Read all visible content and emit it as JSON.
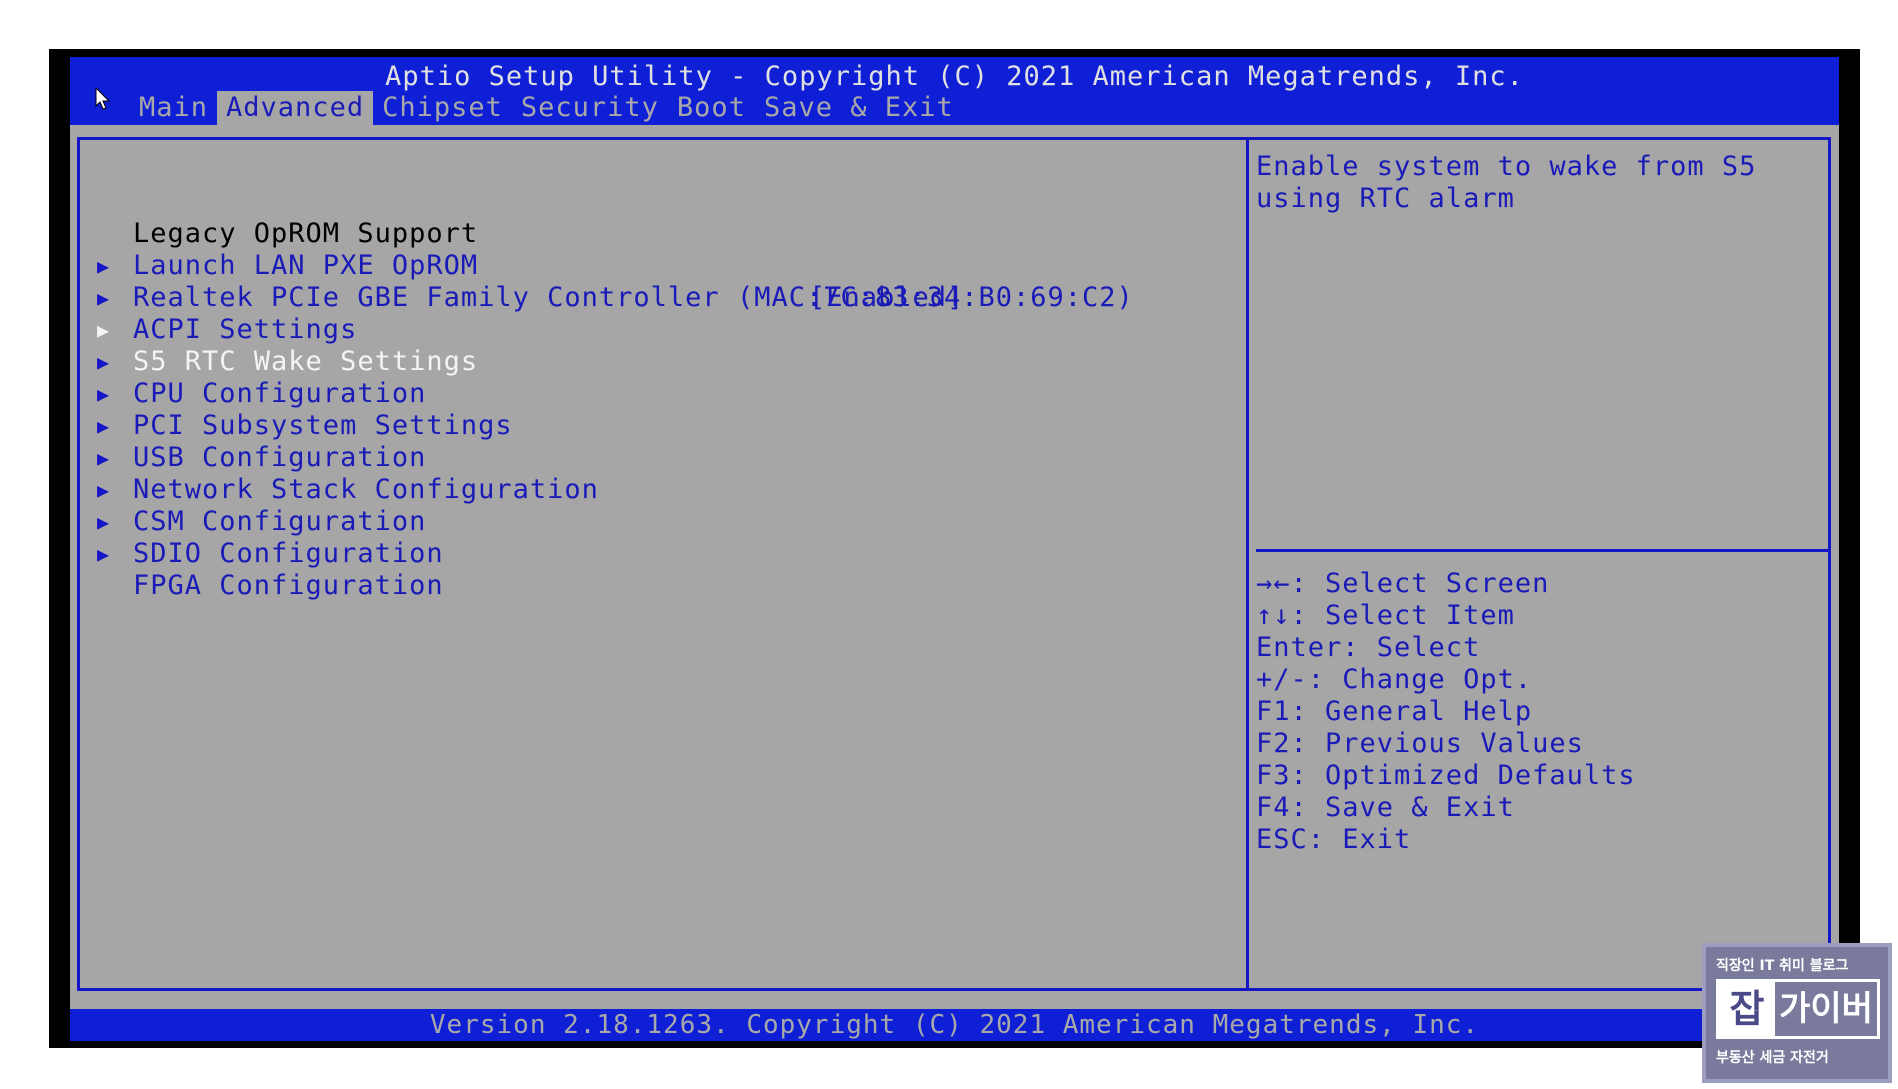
{
  "header": {
    "title": "Aptio Setup Utility - Copyright (C) 2021 American Megatrends, Inc.",
    "tabs": [
      {
        "label": "Main",
        "active": false
      },
      {
        "label": "Advanced",
        "active": true
      },
      {
        "label": "Chipset",
        "active": false
      },
      {
        "label": "Security",
        "active": false
      },
      {
        "label": "Boot",
        "active": false
      },
      {
        "label": "Save & Exit",
        "active": false
      }
    ]
  },
  "menu": {
    "items": [
      {
        "label": "Legacy OpROM Support",
        "type": "heading",
        "value": "",
        "arrow": ""
      },
      {
        "label": "Launch LAN PXE OpROM",
        "type": "option",
        "value": "[Enabled]",
        "arrow": ""
      },
      {
        "label": "Realtek PCIe GBE Family Controller (MAC:7C:83:34:B0:69:C2)",
        "type": "submenu",
        "value": "",
        "arrow": "▶"
      },
      {
        "label": "ACPI Settings",
        "type": "submenu",
        "value": "",
        "arrow": "▶"
      },
      {
        "label": "S5 RTC Wake Settings",
        "type": "submenu",
        "value": "",
        "arrow": "▶",
        "selected": true
      },
      {
        "label": "CPU Configuration",
        "type": "submenu",
        "value": "",
        "arrow": "▶"
      },
      {
        "label": "PCI Subsystem Settings",
        "type": "submenu",
        "value": "",
        "arrow": "▶"
      },
      {
        "label": "USB Configuration",
        "type": "submenu",
        "value": "",
        "arrow": "▶"
      },
      {
        "label": "Network Stack Configuration",
        "type": "submenu",
        "value": "",
        "arrow": "▶"
      },
      {
        "label": "CSM Configuration",
        "type": "submenu",
        "value": "",
        "arrow": "▶"
      },
      {
        "label": "SDIO Configuration",
        "type": "submenu",
        "value": "",
        "arrow": "▶"
      },
      {
        "label": "FPGA Configuration",
        "type": "submenu",
        "value": "",
        "arrow": "▶"
      }
    ]
  },
  "help": {
    "lines": [
      "Enable system to wake from S5",
      "using RTC alarm"
    ]
  },
  "keys": [
    "→←: Select Screen",
    "↑↓: Select Item",
    "Enter: Select",
    "+/-: Change Opt.",
    "F1: General Help",
    "F2: Previous Values",
    "F3: Optimized Defaults",
    "F4: Save & Exit",
    "ESC: Exit"
  ],
  "footer": {
    "version": "Version 2.18.1263. Copyright (C) 2021 American Megatrends, Inc."
  },
  "watermark": {
    "top": "직장인 IT 취미 블로그",
    "left": "잡",
    "right": "가이버",
    "bottom": "부동산 세금 자전거"
  },
  "colors": {
    "header_blue": "#0f1fd6",
    "panel_gray": "#a6a6a6",
    "text_blue": "#1a1ab8",
    "selected_white": "#f4f4f4"
  },
  "icons": {
    "cursor": "mouse-pointer-icon",
    "submenu": "triangle-right-icon"
  }
}
